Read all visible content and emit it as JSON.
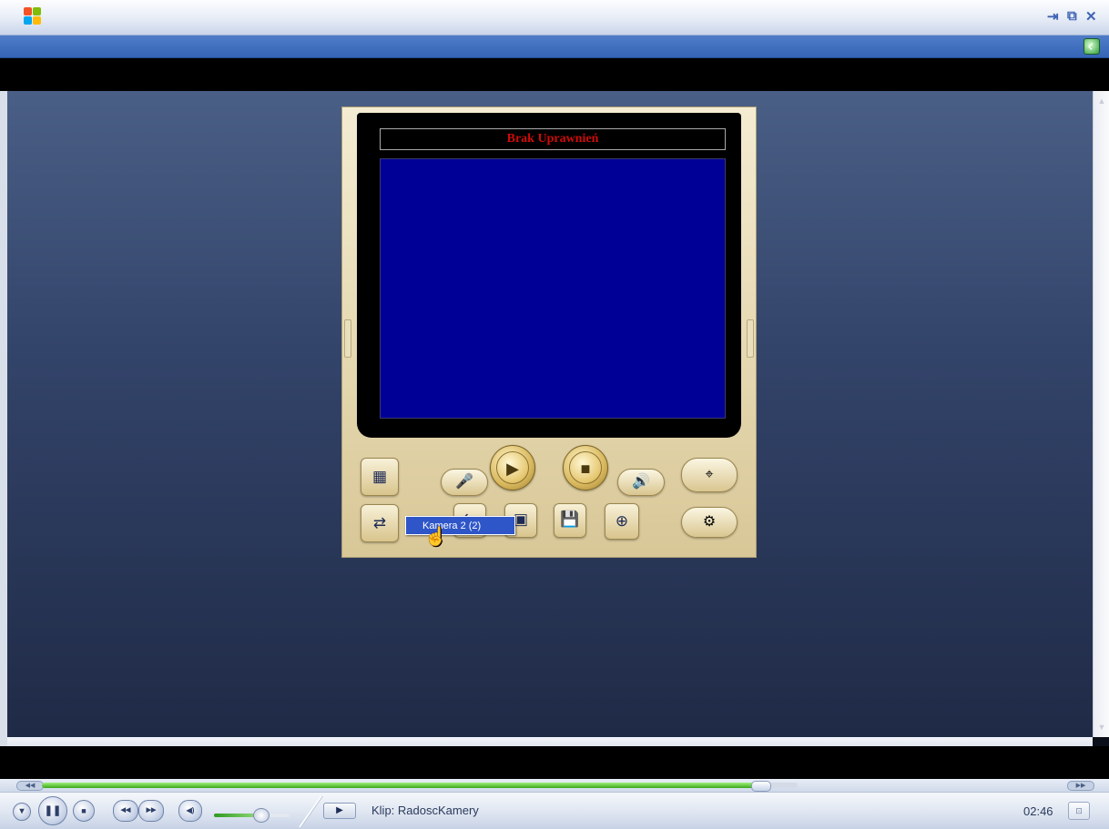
{
  "window": {
    "pin_glyph": "⇥",
    "restore_glyph": "⧉",
    "close_glyph": "✕"
  },
  "camera_viewer": {
    "header_text": "Brak Uprawnień",
    "dropdown_item": "Kamera 2 (2)",
    "icons": {
      "layout": "▦",
      "switch": "⇄",
      "mic": "🎤",
      "play": "▶",
      "stop": "■",
      "speaker": "🔊",
      "ptz": "⌖",
      "snapshot": "▣",
      "record": "◉",
      "save": "💾",
      "zoom": "⊕",
      "settings": "⚙",
      "network": "⇆"
    }
  },
  "player": {
    "seek_progress": 0.95,
    "clip_label": "Klip: RadoscKamery",
    "time": "02:46",
    "volume_level": 0.7,
    "glyphs": {
      "menu": "▾",
      "pause": "❚❚",
      "stop": "■",
      "prev": "◀◀",
      "next": "▶▶",
      "mute": "◀)",
      "clip_play": "▶",
      "seek_back": "◀◀",
      "seek_forward": "▶▶",
      "mini": "⊡"
    }
  },
  "colors": {
    "camera_screen": "#000096",
    "header_text": "#d00a0a",
    "progress_fill": "#3ba71b",
    "titlebar_accent": "#3565b6"
  }
}
